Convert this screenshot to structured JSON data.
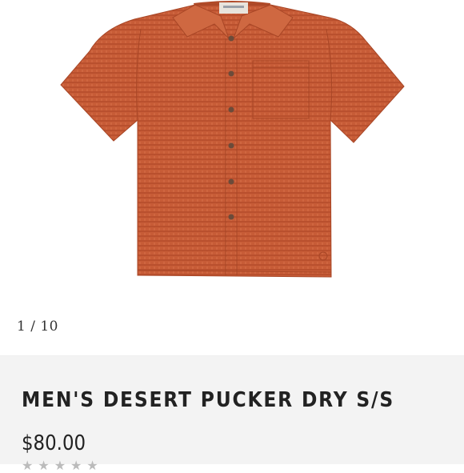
{
  "gallery": {
    "counter": "1 / 10",
    "image_icon": "shirt-product-image",
    "shirt_color": "#c55a35"
  },
  "product": {
    "title": "MEN'S DESERT PUCKER DRY S/S",
    "price": "$80.00",
    "rating_stars": 5,
    "star_icon": "star-icon"
  }
}
